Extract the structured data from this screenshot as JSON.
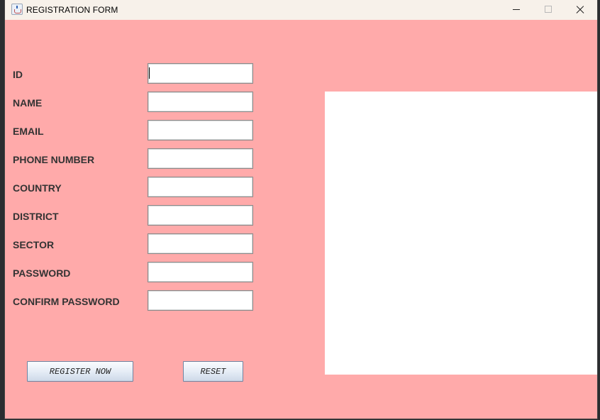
{
  "window": {
    "title": "REGISTRATION FORM"
  },
  "form": {
    "fields": [
      {
        "label": "ID",
        "value": ""
      },
      {
        "label": "NAME",
        "value": ""
      },
      {
        "label": "EMAIL",
        "value": ""
      },
      {
        "label": "PHONE NUMBER",
        "value": ""
      },
      {
        "label": "COUNTRY",
        "value": ""
      },
      {
        "label": "DISTRICT",
        "value": ""
      },
      {
        "label": "SECTOR",
        "value": ""
      },
      {
        "label": "PASSWORD",
        "value": ""
      },
      {
        "label": "CONFIRM PASSWORD",
        "value": ""
      }
    ],
    "buttons": {
      "register_label": "REGISTER NOW",
      "reset_label": "RESET"
    }
  },
  "colors": {
    "form_background": "#ffaaaa",
    "panel_background": "#ffffff",
    "titlebar_background": "#f7f1ea"
  }
}
